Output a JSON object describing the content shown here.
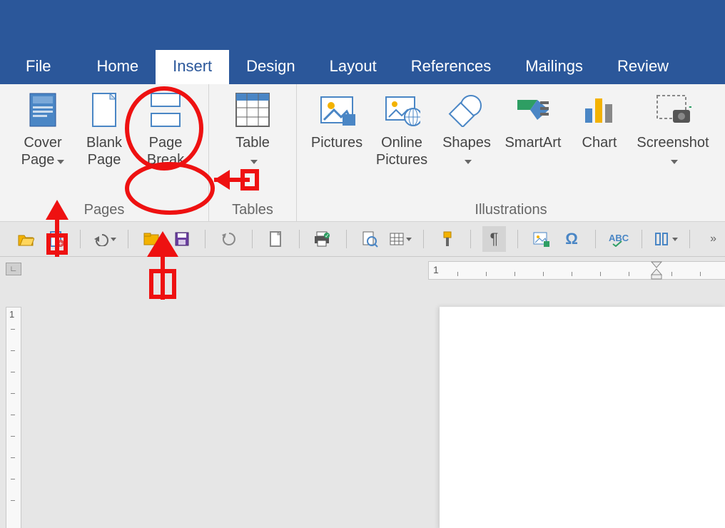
{
  "tabs": {
    "file": "File",
    "home": "Home",
    "insert": "Insert",
    "design": "Design",
    "layout": "Layout",
    "references": "References",
    "mailings": "Mailings",
    "review": "Review"
  },
  "ribbon": {
    "pages": {
      "label": "Pages",
      "cover_page": "Cover\nPage",
      "blank_page": "Blank\nPage",
      "page_break": "Page\nBreak"
    },
    "tables": {
      "label": "Tables",
      "table": "Table"
    },
    "illustrations": {
      "label": "Illustrations",
      "pictures": "Pictures",
      "online_pictures": "Online\nPictures",
      "shapes": "Shapes",
      "smartart": "SmartArt",
      "chart": "Chart",
      "screenshot": "Screenshot"
    }
  },
  "icons": {
    "open": "open",
    "new": "new",
    "undo": "undo",
    "folder": "folder",
    "save": "save",
    "refresh": "refresh",
    "blank": "blank",
    "print": "print",
    "preview": "preview",
    "grid": "grid",
    "brush": "brush",
    "pilcrow": "¶",
    "picture": "picture",
    "omega": "Ω",
    "spell": "spell",
    "columns": "columns"
  },
  "ruler": {
    "start": "1"
  }
}
